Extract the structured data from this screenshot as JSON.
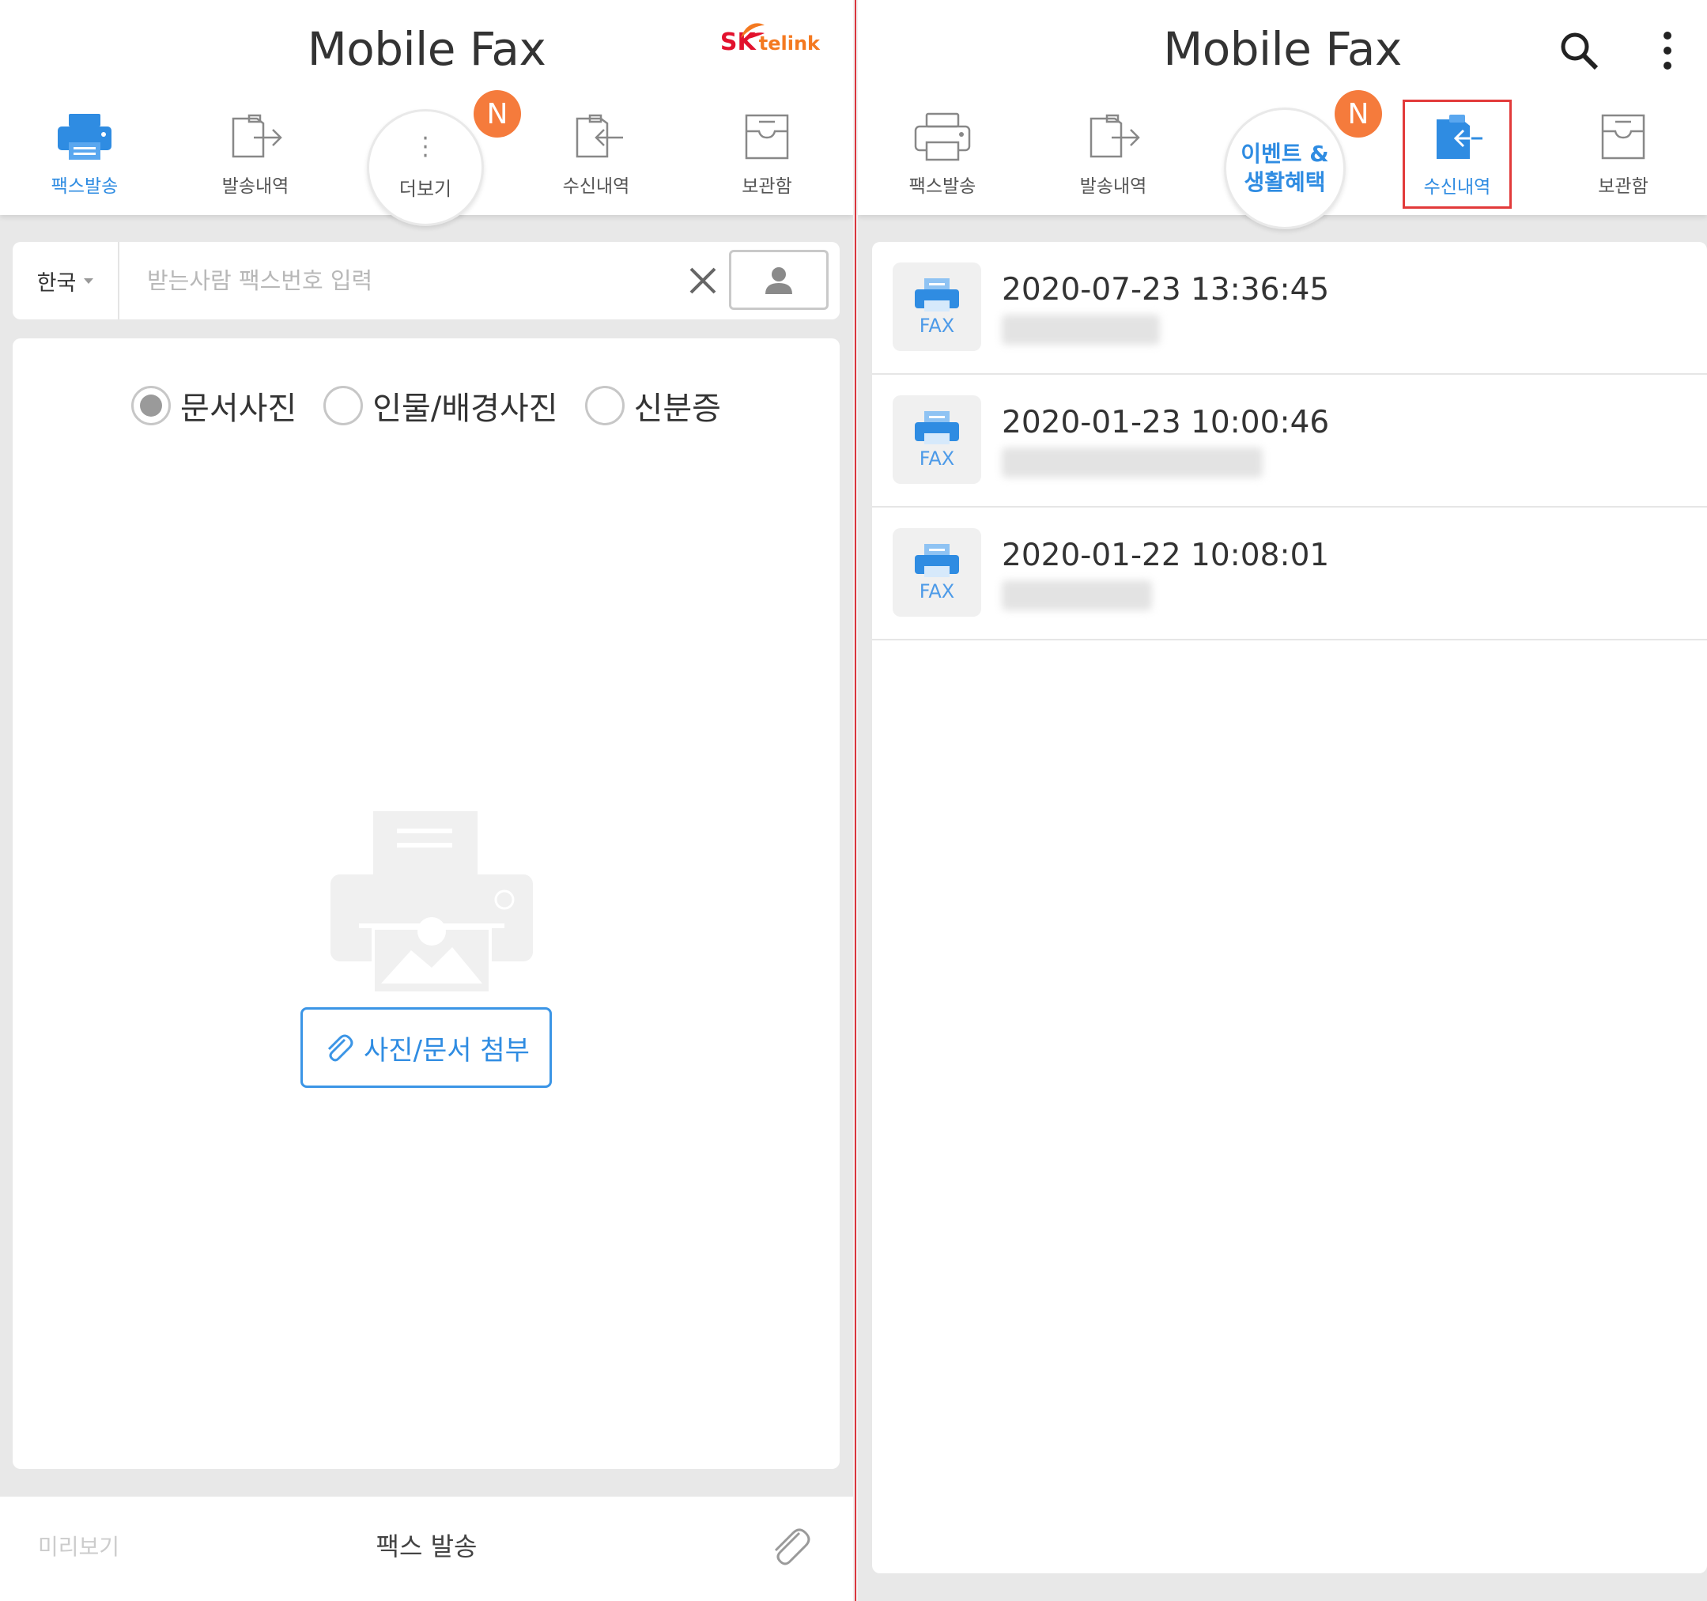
{
  "left": {
    "title": "Mobile Fax",
    "brand": {
      "sk": "SK",
      "telink": "telink"
    },
    "nav": [
      {
        "label": "팩스발송",
        "icon": "printer-icon",
        "active": true
      },
      {
        "label": "발송내역",
        "icon": "sent-history-icon",
        "active": false
      },
      {
        "label": "더보기",
        "icon": "more-dots-icon",
        "active": false
      },
      {
        "label": "수신내역",
        "icon": "received-history-icon",
        "active": false
      },
      {
        "label": "보관함",
        "icon": "archive-box-icon",
        "active": false
      }
    ],
    "badge": "N",
    "recipient": {
      "country": "한국",
      "placeholder": "받는사람 팩스번호 입력",
      "value": ""
    },
    "photo_types": [
      {
        "label": "문서사진",
        "checked": true
      },
      {
        "label": "인물/배경사진",
        "checked": false
      },
      {
        "label": "신분증",
        "checked": false
      }
    ],
    "attach_label": "사진/문서 첨부",
    "bottom": {
      "preview": "미리보기",
      "send": "팩스 발송"
    }
  },
  "right": {
    "title": "Mobile Fax",
    "nav": [
      {
        "label": "팩스발송",
        "icon": "printer-icon",
        "active": false
      },
      {
        "label": "발송내역",
        "icon": "sent-history-icon",
        "active": false
      },
      {
        "label": "이벤트 & 생활혜택",
        "icon": "event-benefits",
        "active": false
      },
      {
        "label": "수신내역",
        "icon": "received-history-icon",
        "active": true
      },
      {
        "label": "보관함",
        "icon": "archive-box-icon",
        "active": false
      }
    ],
    "event_label_line1": "이벤트 &",
    "event_label_line2": "생활혜택",
    "badge": "N",
    "received": [
      {
        "thumb_label": "FAX",
        "date": "2020-07-23 13:36:45"
      },
      {
        "thumb_label": "FAX",
        "date": "2020-01-23 10:00:46"
      },
      {
        "thumb_label": "FAX",
        "date": "2020-01-22 10:08:01"
      }
    ]
  },
  "colors": {
    "accent": "#2f8ce2",
    "badge": "#f57b3c",
    "highlight_box": "#e23a3a",
    "brand_red": "#e2112d",
    "brand_orange": "#f47920"
  }
}
